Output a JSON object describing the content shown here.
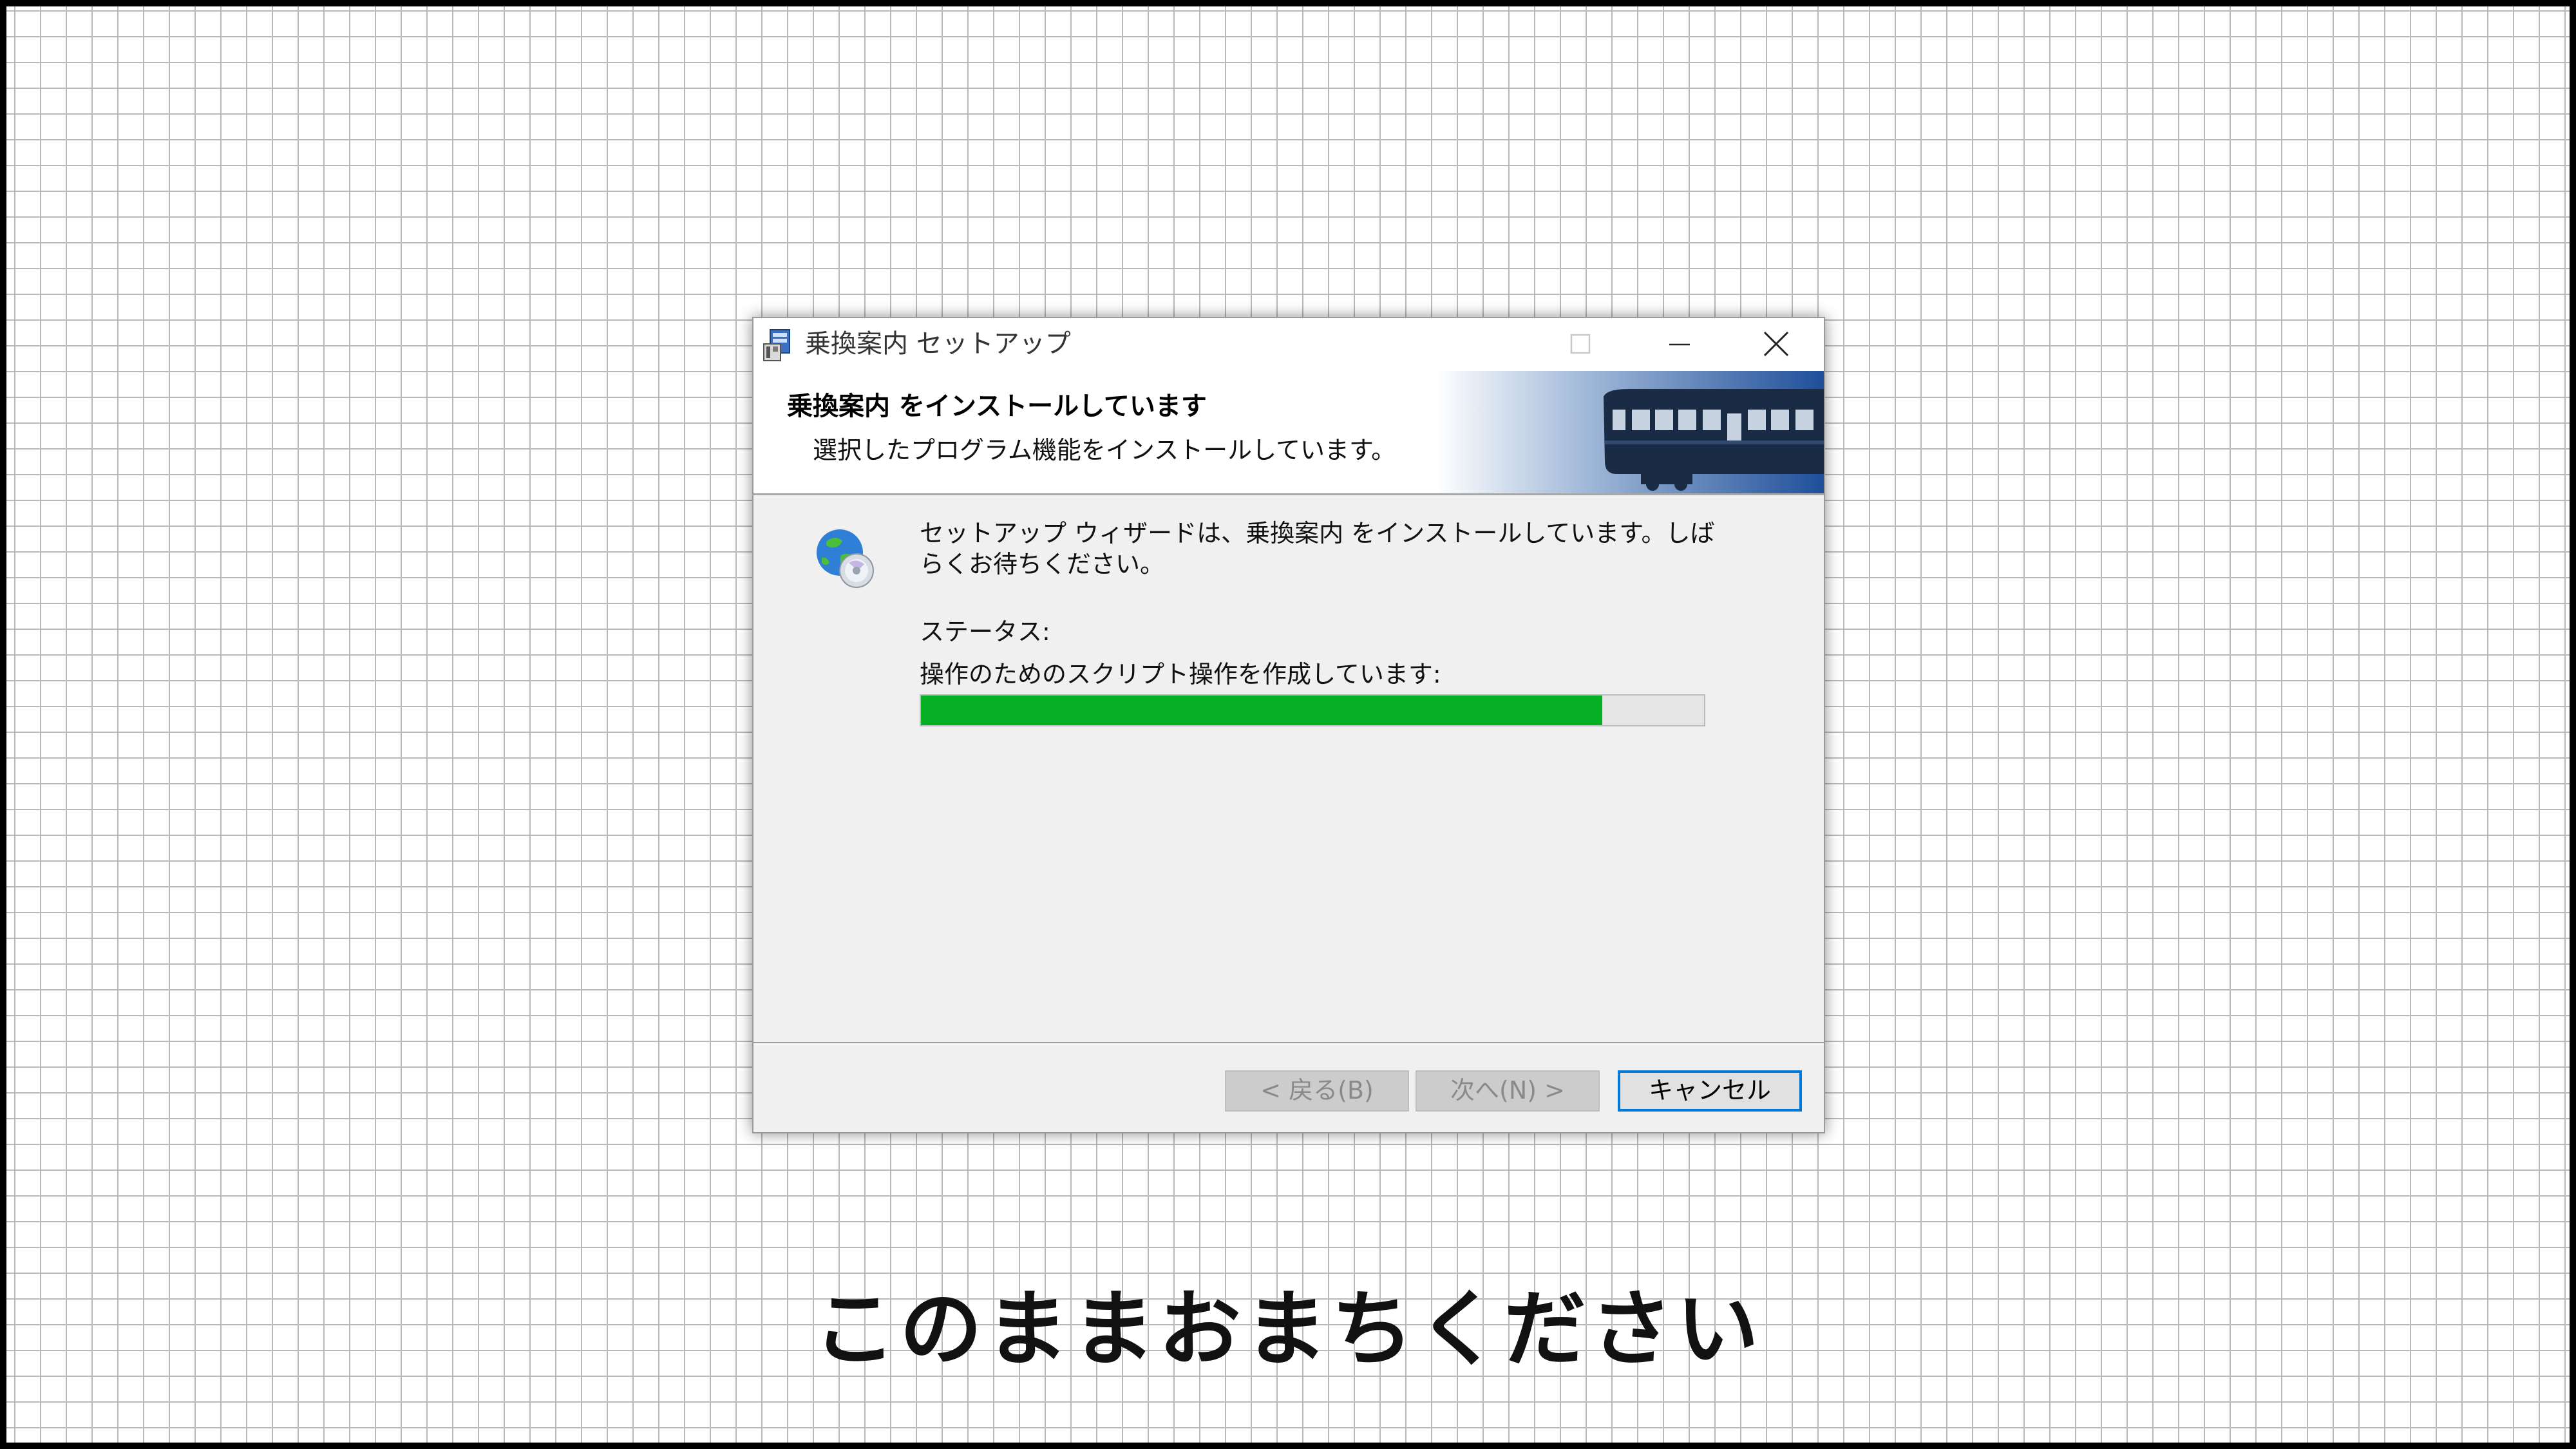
{
  "window": {
    "title": "乗換案内 セットアップ"
  },
  "header": {
    "title": "乗換案内 をインストールしています",
    "subtitle": "選択したプログラム機能をインストールしています。"
  },
  "body": {
    "message": "セットアップ ウィザードは、乗換案内 をインストールしています。しばらくお待ちください。",
    "status_label": "ステータス:",
    "status_text": "操作のためのスクリプト操作を作成しています:",
    "progress_fraction": 0.87
  },
  "buttons": {
    "back": "< 戻る(B)",
    "next": "次へ(N) >",
    "cancel": "キャンセル"
  },
  "caption": "このままおまちください",
  "colors": {
    "progress": "#06b025",
    "focus_border": "#0078d7",
    "banner_blue": "#1f4f9a"
  },
  "icons": {
    "app": "installer-app-icon",
    "wizard": "globe-cd-icon",
    "banner": "train-icon"
  }
}
